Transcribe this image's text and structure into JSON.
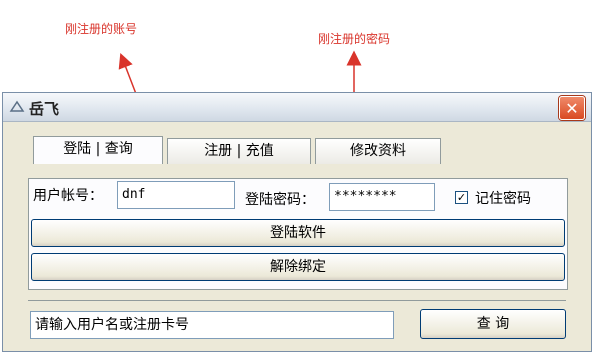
{
  "annotations": {
    "account_note": "刚注册的账号",
    "password_note": "刚注册的密码"
  },
  "window": {
    "title": "岳飞",
    "close_icon": "close-icon"
  },
  "tabs": [
    {
      "label": "登陆 | 查询",
      "active": true
    },
    {
      "label": "注册 | 充值",
      "active": false
    },
    {
      "label": "修改资料",
      "active": false
    }
  ],
  "login": {
    "account_label": "用户帐号：",
    "account_value": "dnf",
    "password_label": "登陆密码：",
    "password_value": "********",
    "remember_label": "记住密码",
    "remember_checked": true,
    "login_button": "登陆软件",
    "unbind_button": "解除绑定"
  },
  "query": {
    "placeholder": "请输入用户名或注册卡号",
    "button": "查 询"
  },
  "colors": {
    "annotation": "#d9342b",
    "close_button": "#d94a22"
  }
}
